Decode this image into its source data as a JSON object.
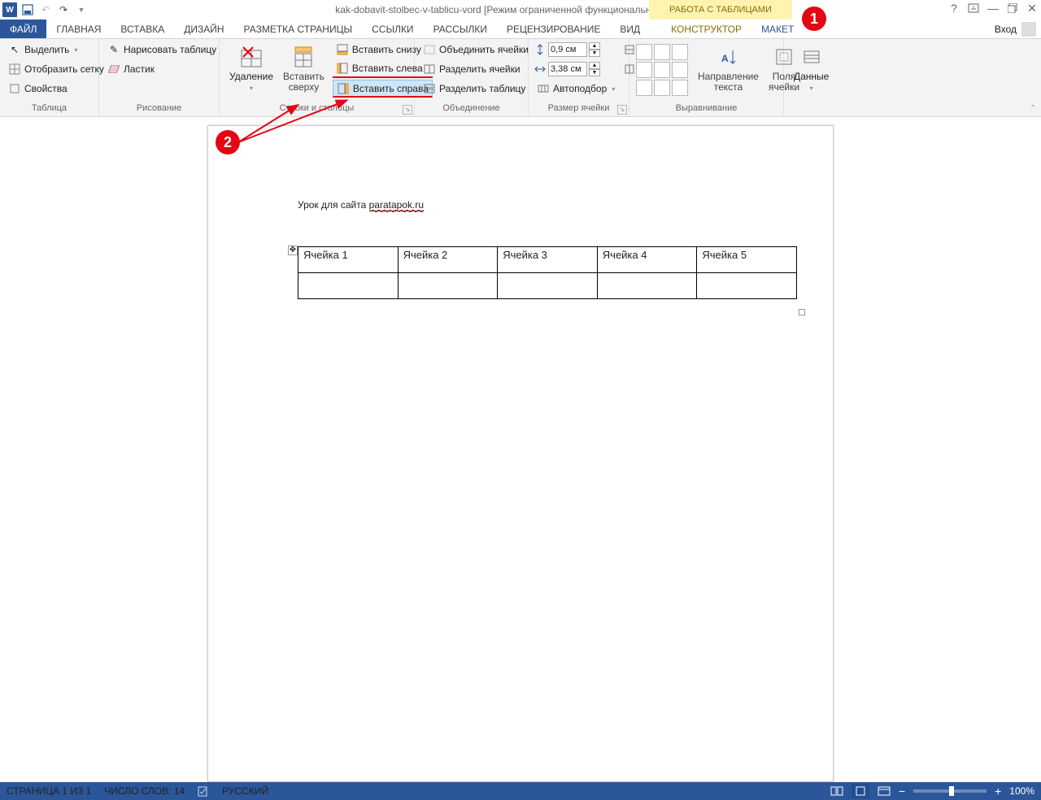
{
  "title": "kak-dobavit-stolbec-v-tablicu-vord [Режим ограниченной функциональности] - Word",
  "table_tools_label": "РАБОТА С ТАБЛИЦАМИ",
  "signin": "Вход",
  "tabs": {
    "file": "ФАЙЛ",
    "home": "ГЛАВНАЯ",
    "insert": "ВСТАВКА",
    "design": "ДИЗАЙН",
    "layout": "РАЗМЕТКА СТРАНИЦЫ",
    "references": "ССЫЛКИ",
    "mailings": "РАССЫЛКИ",
    "review": "РЕЦЕНЗИРОВАНИЕ",
    "view": "ВИД",
    "konstruktor": "КОНСТРУКТОР",
    "maket": "МАКЕТ"
  },
  "ribbon": {
    "table": {
      "label": "Таблица",
      "select": "Выделить",
      "gridlines": "Отобразить сетку",
      "properties": "Свойства"
    },
    "draw": {
      "label": "Рисование",
      "draw_table": "Нарисовать таблицу",
      "eraser": "Ластик"
    },
    "rowscols": {
      "label": "Строки и столбцы",
      "delete": "Удаление",
      "insert_above": "Вставить\nсверху",
      "insert_below": "Вставить снизу",
      "insert_left": "Вставить слева",
      "insert_right": "Вставить справа"
    },
    "merge": {
      "label": "Объединение",
      "merge_cells": "Объединить ячейки",
      "split_cells": "Разделить ячейки",
      "split_table": "Разделить таблицу"
    },
    "cellsize": {
      "label": "Размер ячейки",
      "height": "0,9 см",
      "width": "3,38 см",
      "autofit": "Автоподбор"
    },
    "alignment": {
      "label": "Выравнивание",
      "direction": "Направление\nтекста",
      "margins": "Поля\nячейки"
    },
    "data": {
      "label": "",
      "data_btn": "Данные"
    }
  },
  "document": {
    "heading_prefix": "Урок для сайта ",
    "heading_link": "paratapok.ru",
    "cells": [
      "Ячейка 1",
      "Ячейка 2",
      "Ячейка 3",
      "Ячейка 4",
      "Ячейка 5"
    ]
  },
  "status": {
    "page": "СТРАНИЦА 1 ИЗ 1",
    "words": "ЧИСЛО СЛОВ: 14",
    "lang": "РУССКИЙ",
    "zoom": "100%"
  },
  "annotations": {
    "a1": "1",
    "a2": "2"
  }
}
